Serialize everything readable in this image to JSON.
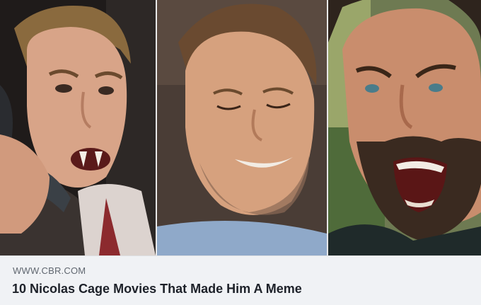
{
  "link_preview": {
    "domain": "WWW.CBR.COM",
    "title": "10 Nicolas Cage Movies That Made Him A Meme"
  },
  "colors": {
    "card_background": "#f0f2f5",
    "domain_text": "#606770",
    "title_text": "#1d2129"
  }
}
